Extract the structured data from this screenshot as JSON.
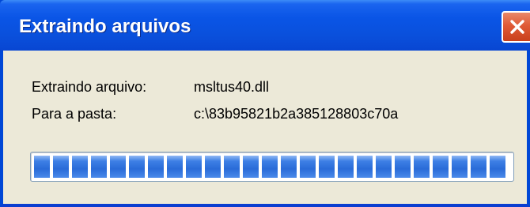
{
  "window": {
    "title": "Extraindo arquivos"
  },
  "dialog": {
    "extracting_label": "Extraindo arquivo:",
    "extracting_value": "msltus40.dll",
    "folder_label": "Para a pasta:",
    "folder_value": "c:\\83b95821b2a385128803c70a"
  },
  "progress": {
    "percent": 100,
    "segments": 25
  },
  "icons": {
    "close": "close-icon"
  },
  "colors": {
    "titlebar": "#0a55e6",
    "client_background": "#ece9d8",
    "progress_fill": "#2a6bd8",
    "close_button": "#e05a36"
  }
}
